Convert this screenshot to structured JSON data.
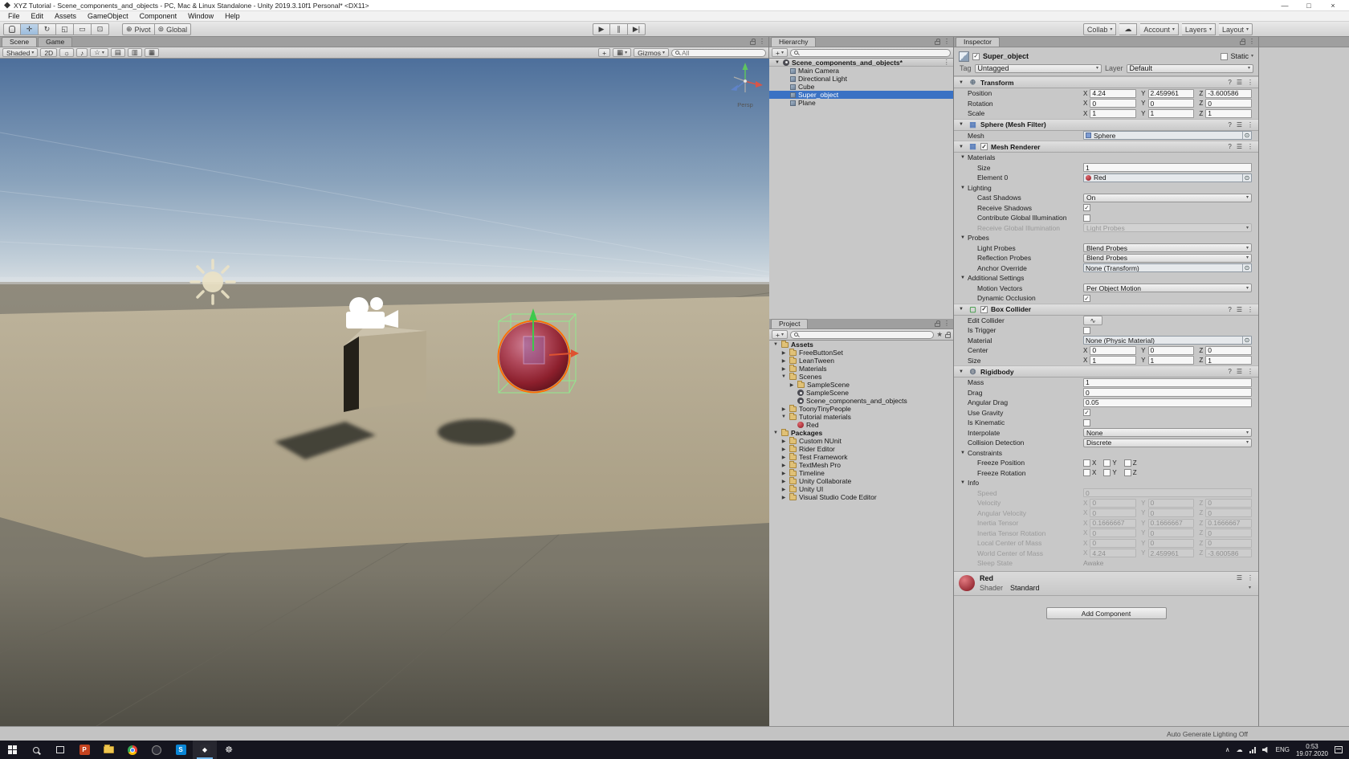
{
  "window": {
    "title": "XYZ Tutorial - Scene_components_and_objects - PC, Mac & Linux Standalone - Unity 2019.3.10f1 Personal* <DX11>",
    "controls": {
      "minimize": "—",
      "maximize": "□",
      "close": "×"
    }
  },
  "menu_bar": {
    "items": [
      "File",
      "Edit",
      "Assets",
      "GameObject",
      "Component",
      "Window",
      "Help"
    ]
  },
  "toolbar": {
    "tools": [
      {
        "name": "hand-tool",
        "glyph": ""
      },
      {
        "name": "move-tool",
        "glyph": "✛",
        "active": true
      },
      {
        "name": "rotate-tool",
        "glyph": "↻"
      },
      {
        "name": "scale-tool",
        "glyph": "◱"
      },
      {
        "name": "rect-tool",
        "glyph": "▭"
      },
      {
        "name": "transform-tool",
        "glyph": "⊡"
      }
    ],
    "pivot": "Pivot",
    "global": "Global",
    "transport": [
      {
        "name": "play-button",
        "glyph": "▶"
      },
      {
        "name": "pause-button",
        "glyph": "∥"
      },
      {
        "name": "step-button",
        "glyph": "▶|"
      }
    ],
    "collab": "Collab",
    "account": "Account",
    "layers": "Layers",
    "layout": "Layout"
  },
  "scene_view": {
    "tabs": [
      {
        "label": "Scene",
        "active": true
      },
      {
        "label": "Game",
        "active": false
      }
    ],
    "shaded_label": "Shaded",
    "mode_2d": "2D",
    "gizmos_label": "Gizmos",
    "search_text": "All",
    "projection_label": "Persp"
  },
  "hierarchy": {
    "tab": "Hierarchy",
    "scene_name": "Scene_components_and_objects*",
    "items": [
      {
        "label": "Main Camera",
        "icon": "camera-icon"
      },
      {
        "label": "Directional Light",
        "icon": "light-icon"
      },
      {
        "label": "Cube",
        "icon": "cube-icon"
      },
      {
        "label": "Super_object",
        "icon": "gameobject-icon",
        "selected": true
      },
      {
        "label": "Plane",
        "icon": "plane-icon"
      }
    ]
  },
  "project": {
    "tab": "Project",
    "rows": [
      {
        "label": "Assets",
        "indent": 0,
        "arrow": "down",
        "icon": "folder-icon",
        "bold": true
      },
      {
        "label": "FreeButtonSet",
        "indent": 1,
        "arrow": "right",
        "icon": "folder-icon"
      },
      {
        "label": "LeanTween",
        "indent": 1,
        "arrow": "right",
        "icon": "folder-icon"
      },
      {
        "label": "Materials",
        "indent": 1,
        "arrow": "right",
        "icon": "folder-icon"
      },
      {
        "label": "Scenes",
        "indent": 1,
        "arrow": "down",
        "icon": "folder-icon"
      },
      {
        "label": "SampleScene",
        "indent": 2,
        "arrow": "right",
        "icon": "folder-icon"
      },
      {
        "label": "SampleScene",
        "indent": 2,
        "arrow": null,
        "icon": "scene-icon"
      },
      {
        "label": "Scene_components_and_objects",
        "indent": 2,
        "arrow": null,
        "icon": "scene-icon"
      },
      {
        "label": "ToonyTinyPeople",
        "indent": 1,
        "arrow": "right",
        "icon": "folder-icon"
      },
      {
        "label": "Tutorial materials",
        "indent": 1,
        "arrow": "down",
        "icon": "folder-icon"
      },
      {
        "label": "Red",
        "indent": 2,
        "arrow": null,
        "icon": "material-icon"
      },
      {
        "label": "Packages",
        "indent": 0,
        "arrow": "down",
        "icon": "folder-icon",
        "bold": true
      },
      {
        "label": "Custom NUnit",
        "indent": 1,
        "arrow": "right",
        "icon": "folder-icon"
      },
      {
        "label": "Rider Editor",
        "indent": 1,
        "arrow": "right",
        "icon": "folder-icon"
      },
      {
        "label": "Test Framework",
        "indent": 1,
        "arrow": "right",
        "icon": "folder-icon"
      },
      {
        "label": "TextMesh Pro",
        "indent": 1,
        "arrow": "right",
        "icon": "folder-icon"
      },
      {
        "label": "Timeline",
        "indent": 1,
        "arrow": "right",
        "icon": "folder-icon"
      },
      {
        "label": "Unity Collaborate",
        "indent": 1,
        "arrow": "right",
        "icon": "folder-icon"
      },
      {
        "label": "Unity UI",
        "indent": 1,
        "arrow": "right",
        "icon": "folder-icon"
      },
      {
        "label": "Visual Studio Code Editor",
        "indent": 1,
        "arrow": "right",
        "icon": "folder-icon"
      }
    ]
  },
  "inspector": {
    "tab": "Inspector",
    "axes": [
      "X",
      "Y",
      "Z"
    ],
    "header": {
      "name": "Super_object",
      "static_label": "Static",
      "tag_label": "Tag",
      "tag_value": "Untagged",
      "layer_label": "Layer",
      "layer_value": "Default"
    },
    "sections": [
      {
        "title": "Transform",
        "icon": "transform-icon",
        "glyph": "⊕",
        "rows": [
          {
            "label": "Position",
            "type": "vector3",
            "x": "4.24",
            "y": "2.459961",
            "z": "-3.600586"
          },
          {
            "label": "Rotation",
            "type": "vector3",
            "x": "0",
            "y": "0",
            "z": "0"
          },
          {
            "label": "Scale",
            "type": "vector3",
            "x": "1",
            "y": "1",
            "z": "1"
          }
        ]
      },
      {
        "title": "Sphere (Mesh Filter)",
        "icon": "mesh-filter-icon",
        "glyph": "▦",
        "rows": [
          {
            "label": "Mesh",
            "type": "object",
            "value": "Sphere",
            "dot": "mesh"
          }
        ]
      },
      {
        "title": "Mesh Renderer",
        "icon": "mesh-renderer-icon",
        "glyph": "▦",
        "enabled": true,
        "rows": [
          {
            "label": "Materials",
            "type": "foldout"
          },
          {
            "label": "Size",
            "type": "text",
            "value": "1",
            "indent": 1
          },
          {
            "label": "Element 0",
            "type": "object",
            "value": "Red",
            "dot": "red",
            "indent": 1
          },
          {
            "label": "Lighting",
            "type": "foldout"
          },
          {
            "label": "Cast Shadows",
            "type": "dropdown",
            "value": "On",
            "indent": 1
          },
          {
            "label": "Receive Shadows",
            "type": "checkbox",
            "checked": true,
            "indent": 1
          },
          {
            "label": "Contribute Global Illumination",
            "type": "checkbox",
            "checked": false,
            "indent": 1
          },
          {
            "label": "Receive Global Illumination",
            "type": "dropdown",
            "value": "Light Probes",
            "disabled": true,
            "indent": 1
          },
          {
            "label": "Probes",
            "type": "foldout"
          },
          {
            "label": "Light Probes",
            "type": "dropdown",
            "value": "Blend Probes",
            "indent": 1
          },
          {
            "label": "Reflection Probes",
            "type": "dropdown",
            "value": "Blend Probes",
            "indent": 1
          },
          {
            "label": "Anchor Override",
            "type": "object",
            "value": "None (Transform)",
            "indent": 1
          },
          {
            "label": "Additional Settings",
            "type": "foldout"
          },
          {
            "label": "Motion Vectors",
            "type": "dropdown",
            "value": "Per Object Motion",
            "indent": 1
          },
          {
            "label": "Dynamic Occlusion",
            "type": "checkbox",
            "checked": true,
            "indent": 1
          }
        ]
      },
      {
        "title": "Box Collider",
        "icon": "box-collider-icon",
        "glyph": "▢",
        "enabled": true,
        "rows": [
          {
            "label": "Edit Collider",
            "type": "button"
          },
          {
            "label": "Is Trigger",
            "type": "checkbox",
            "checked": false
          },
          {
            "label": "Material",
            "type": "object",
            "value": "None (Physic Material)"
          },
          {
            "label": "Center",
            "type": "vector3",
            "x": "0",
            "y": "0",
            "z": "0"
          },
          {
            "label": "Size",
            "type": "vector3",
            "x": "1",
            "y": "1",
            "z": "1"
          }
        ]
      },
      {
        "title": "Rigidbody",
        "icon": "rigidbody-icon",
        "glyph": "◍",
        "rows": [
          {
            "label": "Mass",
            "type": "text",
            "value": "1"
          },
          {
            "label": "Drag",
            "type": "text",
            "value": "0"
          },
          {
            "label": "Angular Drag",
            "type": "text",
            "value": "0.05"
          },
          {
            "label": "Use Gravity",
            "type": "checkbox",
            "checked": true
          },
          {
            "label": "Is Kinematic",
            "type": "checkbox",
            "checked": false
          },
          {
            "label": "Interpolate",
            "type": "dropdown",
            "value": "None"
          },
          {
            "label": "Collision Detection",
            "type": "dropdown",
            "value": "Discrete"
          },
          {
            "label": "Constraints",
            "type": "foldout"
          },
          {
            "label": "Freeze Position",
            "type": "xyz",
            "indent": 1
          },
          {
            "label": "Freeze Rotation",
            "type": "xyz",
            "indent": 1
          },
          {
            "label": "Info",
            "type": "foldout"
          },
          {
            "label": "Speed",
            "type": "text",
            "value": "0",
            "disabled": true,
            "indent": 1
          },
          {
            "label": "Velocity",
            "type": "vector3",
            "x": "0",
            "y": "0",
            "z": "0",
            "disabled": true,
            "indent": 1
          },
          {
            "label": "Angular Velocity",
            "type": "vector3",
            "x": "0",
            "y": "0",
            "z": "0",
            "disabled": true,
            "indent": 1
          },
          {
            "label": "Inertia Tensor",
            "type": "vector3",
            "x": "0.1666667",
            "y": "0.1666667",
            "z": "0.1666667",
            "disabled": true,
            "indent": 1
          },
          {
            "label": "Inertia Tensor Rotation",
            "type": "vector3",
            "x": "0",
            "y": "0",
            "z": "0",
            "disabled": true,
            "indent": 1
          },
          {
            "label": "Local Center of Mass",
            "type": "vector3",
            "x": "0",
            "y": "0",
            "z": "0",
            "disabled": true,
            "indent": 1
          },
          {
            "label": "World Center of Mass",
            "type": "vector3",
            "x": "4.24",
            "y": "2.459961",
            "z": "-3.600586",
            "disabled": true,
            "indent": 1
          },
          {
            "label": "Sleep State",
            "type": "plain",
            "value": "Awake",
            "disabled": true,
            "indent": 1
          }
        ]
      }
    ],
    "material": {
      "name": "Red",
      "shader_label": "Shader",
      "shader_value": "Standard"
    },
    "add_component_label": "Add Component"
  },
  "status_bar": {
    "auto_generate_lighting": "Auto Generate Lighting Off"
  },
  "taskbar": {
    "apps": [
      {
        "name": "start-button",
        "type": "start"
      },
      {
        "name": "taskbar-search-button",
        "type": "search"
      },
      {
        "name": "task-view-button",
        "type": "taskview"
      },
      {
        "name": "app-powerpoint",
        "type": "letter",
        "letter": "P",
        "color": "#c4431f"
      },
      {
        "name": "app-file-explorer",
        "type": "folder"
      },
      {
        "name": "app-chrome",
        "type": "chrome"
      },
      {
        "name": "app-media-player",
        "type": "media"
      },
      {
        "name": "app-skype",
        "type": "letter",
        "letter": "S",
        "color": "#0a86d6"
      },
      {
        "name": "app-unity",
        "type": "unity",
        "active": true
      },
      {
        "name": "app-settings",
        "type": "gear"
      }
    ],
    "tray": {
      "chevron": "∧",
      "cloud": "☁",
      "language": "ENG",
      "time": "0:53",
      "date": "19.07.2020"
    }
  },
  "icons": {
    "caret": "▾",
    "fold_open": "▼",
    "fold_closed": "▶",
    "check": "✓",
    "menu": "⋮",
    "help": "?",
    "preset": "☰",
    "picker": "⊙",
    "plus": "+",
    "cloud": "☁",
    "gear": "☸",
    "star": "★",
    "light": "☼",
    "audio": "♪",
    "effects": "☆",
    "grid_a": "▤",
    "grid_b": "▥",
    "grid_c": "▦",
    "crosshair": "+",
    "collider_edit": "∿",
    "pivot_glyph": "⊕",
    "global_glyph": "⊚",
    "unity_glyph": "◆"
  },
  "colors": {
    "selection_blue": "#3a72c4",
    "accent_orange": "#ff6c00",
    "material_red": "#9c1d28",
    "collider_green": "#8ef08e",
    "taskbar_bg": "#15151f",
    "sky_top": "#4d6f9b",
    "ground_plane": "#b3a98f"
  }
}
